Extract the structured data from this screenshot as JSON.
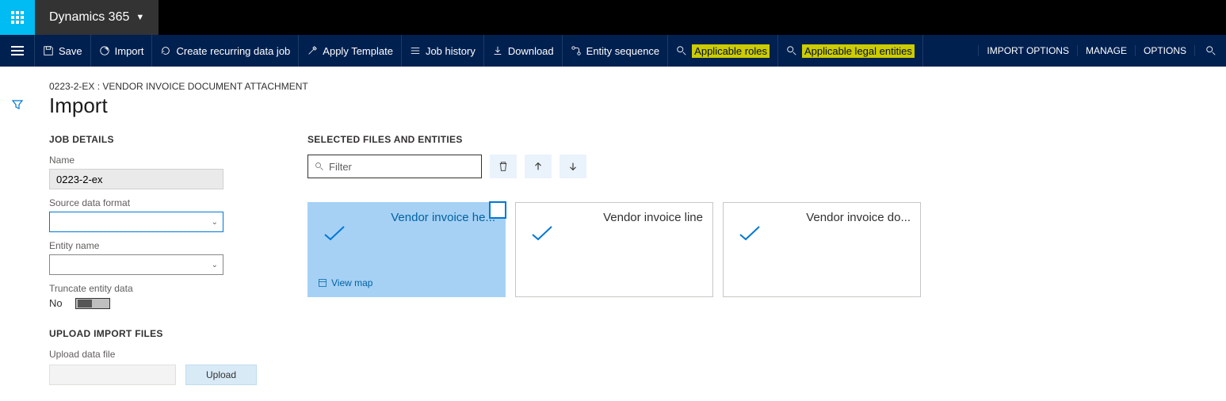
{
  "brand": "Dynamics 365",
  "ribbon": {
    "save": "Save",
    "import": "Import",
    "recurring": "Create recurring data job",
    "applyTemplate": "Apply Template",
    "jobHistory": "Job history",
    "download": "Download",
    "entitySequence": "Entity sequence",
    "applicableRoles": "Applicable roles",
    "applicableLegal": "Applicable legal entities",
    "importOptions": "IMPORT OPTIONS",
    "manage": "MANAGE",
    "options": "OPTIONS"
  },
  "page": {
    "crumb": "0223-2-EX : VENDOR INVOICE DOCUMENT ATTACHMENT",
    "title": "Import"
  },
  "jobDetails": {
    "sectionTitle": "JOB DETAILS",
    "nameLabel": "Name",
    "nameValue": "0223-2-ex",
    "sourceFormatLabel": "Source data format",
    "sourceFormatValue": "",
    "entityNameLabel": "Entity name",
    "entityNameValue": "",
    "truncateLabel": "Truncate entity data",
    "truncateValue": "No"
  },
  "upload": {
    "sectionTitle": "UPLOAD IMPORT FILES",
    "uploadLabel": "Upload data file",
    "uploadButton": "Upload"
  },
  "selected": {
    "sectionTitle": "SELECTED FILES AND ENTITIES",
    "filterPlaceholder": "Filter",
    "cards": [
      {
        "title": "Vendor invoice he...",
        "viewMap": "View map"
      },
      {
        "title": "Vendor invoice line"
      },
      {
        "title": "Vendor invoice do..."
      }
    ]
  }
}
